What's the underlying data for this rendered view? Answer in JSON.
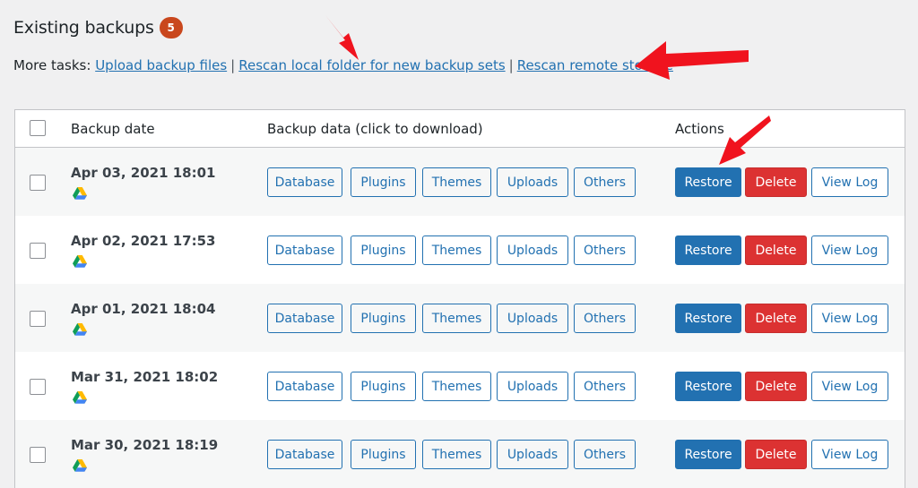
{
  "header": {
    "title": "Existing backups",
    "count": "5"
  },
  "tasks": {
    "prefix": "More tasks:",
    "links": [
      "Upload backup files",
      "Rescan local folder for new backup sets",
      "Rescan remote storage"
    ]
  },
  "table": {
    "columns": [
      "Backup date",
      "Backup data (click to download)",
      "Actions"
    ],
    "data_buttons": [
      "Database",
      "Plugins",
      "Themes",
      "Uploads",
      "Others"
    ],
    "action_buttons": [
      "Restore",
      "Delete",
      "View Log"
    ],
    "rows": [
      {
        "date": "Apr 03, 2021 18:01",
        "storage_icon": "google-drive-icon"
      },
      {
        "date": "Apr 02, 2021 17:53",
        "storage_icon": "google-drive-icon"
      },
      {
        "date": "Apr 01, 2021 18:04",
        "storage_icon": "google-drive-icon"
      },
      {
        "date": "Mar 31, 2021 18:02",
        "storage_icon": "google-drive-icon"
      },
      {
        "date": "Mar 30, 2021 18:19",
        "storage_icon": "google-drive-icon"
      }
    ]
  },
  "colors": {
    "accent": "#2271b1",
    "delete": "#dc3232",
    "badge": "#c9471d",
    "annotation_arrow": "#f0131e"
  }
}
